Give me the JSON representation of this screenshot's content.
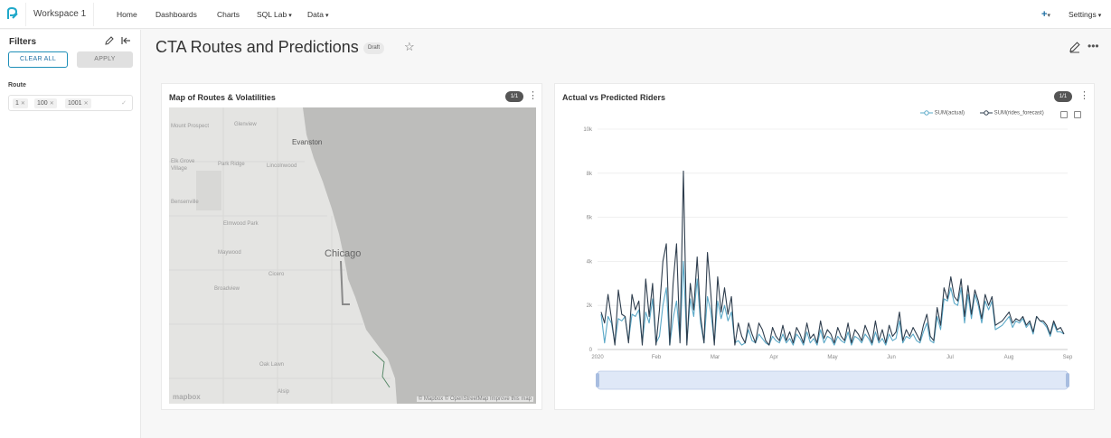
{
  "nav": {
    "workspace": "Workspace 1",
    "items": [
      "Home",
      "Dashboards",
      "Charts",
      "SQL Lab",
      "Data"
    ],
    "settings": "Settings",
    "plus": "+",
    "caret": "▾"
  },
  "sidebar": {
    "title": "Filters",
    "clear_all": "CLEAR ALL",
    "apply": "APPLY",
    "filter_label": "Route",
    "selected_values": [
      "1",
      "100",
      "1001"
    ]
  },
  "header": {
    "title": "CTA Routes and Predictions",
    "badge": "Draft"
  },
  "map_panel": {
    "title": "Map of Routes & Volatilities",
    "pill": "1/1",
    "labels": {
      "evanston": "Evanston",
      "chicago": "Chicago",
      "mount_prospect": "Mount Prospect",
      "glenview": "Glenview",
      "elk_grove": "Elk Grove Village",
      "park_ridge": "Park Ridge",
      "lincolnwood": "Lincolnwood",
      "bensenville": "Bensenville",
      "elmwood_park": "Elmwood Park",
      "maywood": "Maywood",
      "cicero": "Cicero",
      "broadview": "Broadview",
      "oak_lawn": "Oak Lawn",
      "alsip": "Alsip"
    },
    "attribution": "© Mapbox © OpenStreetMap Improve this map",
    "logo": "mapbox"
  },
  "chart_panel": {
    "title": "Actual vs Predicted Riders",
    "pill": "1/1",
    "legend": [
      "SUM(actual)",
      "SUM(rides_forecast)"
    ]
  },
  "colors": {
    "actual": "#5aa8c7",
    "forecast": "#2f3e4e",
    "accent": "#1f8fb8"
  },
  "chart_data": {
    "type": "line",
    "title": "Actual vs Predicted Riders",
    "ylim": [
      0,
      10000
    ],
    "yticks": [
      "0",
      "2k",
      "4k",
      "6k",
      "8k",
      "10k"
    ],
    "xticks": [
      "2020",
      "Feb",
      "Mar",
      "Apr",
      "May",
      "Jun",
      "Jul",
      "Aug",
      "Sep"
    ],
    "grid": true,
    "legend_position": "top-right",
    "series": [
      {
        "name": "SUM(actual)",
        "values": [
          1600,
          300,
          1500,
          1200,
          300,
          1400,
          1300,
          1500,
          400,
          1600,
          1500,
          1800,
          300,
          1700,
          1200,
          2300,
          300,
          600,
          2000,
          2800,
          200,
          1400,
          2200,
          400,
          4000,
          300,
          2300,
          1500,
          3200,
          1200,
          300,
          2400,
          1700,
          300,
          2200,
          1400,
          2000,
          1300,
          1700,
          300,
          400,
          200,
          300,
          900,
          400,
          300,
          700,
          500,
          300,
          200,
          600,
          400,
          300,
          700,
          300,
          500,
          200,
          700,
          500,
          200,
          800,
          300,
          500,
          200,
          900,
          300,
          600,
          500,
          200,
          600,
          400,
          300,
          800,
          200,
          600,
          500,
          300,
          700,
          500,
          200,
          800,
          300,
          500,
          200,
          700,
          400,
          500,
          1300,
          300,
          600,
          500,
          700,
          400,
          300,
          800,
          1200,
          400,
          300,
          1500,
          900,
          2300,
          2200,
          2800,
          2100,
          2000,
          2800,
          1200,
          2500,
          1400,
          2500,
          2000,
          1200,
          2200,
          1800,
          2200,
          900,
          1000,
          1100,
          1300,
          1500,
          1000,
          1300,
          1200,
          1400,
          1000,
          1200,
          700,
          1500,
          1300,
          1200,
          1000,
          600,
          1200,
          800,
          800,
          700
        ]
      },
      {
        "name": "SUM(rides_forecast)",
        "values": [
          1700,
          1200,
          2500,
          1400,
          200,
          2700,
          1600,
          1500,
          300,
          2500,
          1800,
          2200,
          200,
          3200,
          1500,
          3000,
          200,
          1800,
          4000,
          4800,
          200,
          3000,
          4800,
          300,
          8100,
          200,
          3000,
          1800,
          4200,
          1500,
          300,
          4400,
          2500,
          200,
          3300,
          1700,
          2800,
          1600,
          2400,
          200,
          1200,
          600,
          300,
          1200,
          700,
          300,
          1200,
          900,
          400,
          200,
          1000,
          600,
          400,
          1100,
          400,
          800,
          300,
          1000,
          700,
          300,
          1200,
          500,
          700,
          300,
          1300,
          500,
          900,
          700,
          300,
          1000,
          600,
          400,
          1200,
          300,
          900,
          700,
          400,
          1100,
          700,
          300,
          1300,
          400,
          900,
          300,
          1100,
          600,
          800,
          1700,
          400,
          900,
          600,
          1000,
          700,
          400,
          1100,
          1600,
          600,
          400,
          1900,
          1100,
          2800,
          2300,
          3300,
          2400,
          2200,
          3200,
          1500,
          2900,
          1600,
          2700,
          2200,
          1400,
          2500,
          2000,
          2400,
          1100,
          1200,
          1300,
          1500,
          1700,
          1200,
          1400,
          1300,
          1500,
          1100,
          1300,
          800,
          1500,
          1300,
          1300,
          1100,
          700,
          1300,
          900,
          1000,
          700
        ]
      }
    ]
  }
}
